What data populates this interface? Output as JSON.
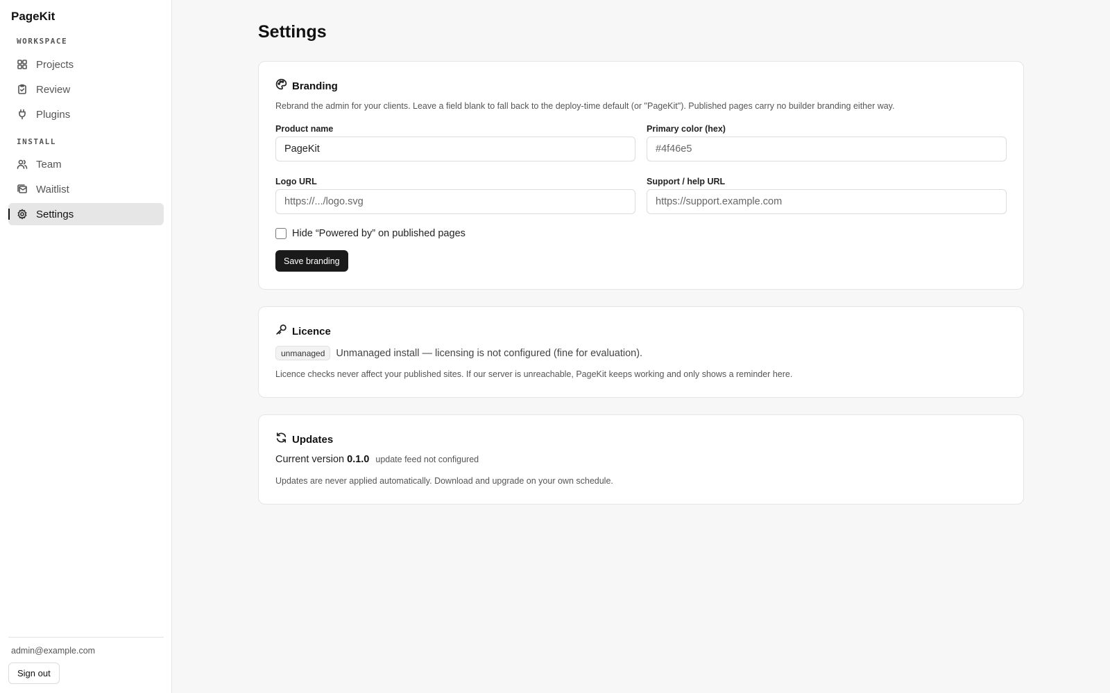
{
  "sidebar": {
    "brand": "PageKit",
    "sections": [
      {
        "label": "WORKSPACE",
        "items": [
          {
            "label": "Projects",
            "icon": "grid-icon"
          },
          {
            "label": "Review",
            "icon": "clipboard-check-icon"
          },
          {
            "label": "Plugins",
            "icon": "plug-icon"
          }
        ]
      },
      {
        "label": "INSTALL",
        "items": [
          {
            "label": "Team",
            "icon": "users-icon"
          },
          {
            "label": "Waitlist",
            "icon": "mail-stack-icon"
          },
          {
            "label": "Settings",
            "icon": "gear-icon",
            "active": true
          }
        ]
      }
    ],
    "user_email": "admin@example.com",
    "sign_out_label": "Sign out"
  },
  "page": {
    "title": "Settings"
  },
  "branding": {
    "title": "Branding",
    "icon": "palette-icon",
    "description": "Rebrand the admin for your clients. Leave a field blank to fall back to the deploy-time default (or \"PageKit\"). Published pages carry no builder branding either way.",
    "product_name": {
      "label": "Product name",
      "value": "PageKit",
      "placeholder": ""
    },
    "primary_color": {
      "label": "Primary color (hex)",
      "value": "",
      "placeholder": "#4f46e5"
    },
    "logo_url": {
      "label": "Logo URL",
      "value": "",
      "placeholder": "https://.../logo.svg"
    },
    "support_url": {
      "label": "Support / help URL",
      "value": "",
      "placeholder": "https://support.example.com"
    },
    "hide_powered_by_label": "Hide “Powered by” on published pages",
    "hide_powered_by_checked": false,
    "save_label": "Save branding"
  },
  "licence": {
    "title": "Licence",
    "icon": "key-icon",
    "badge": "unmanaged",
    "status_text": "Unmanaged install — licensing is not configured (fine for evaluation).",
    "note": "Licence checks never affect your published sites. If our server is unreachable, PageKit keeps working and only shows a reminder here."
  },
  "updates": {
    "title": "Updates",
    "icon": "refresh-icon",
    "version_label": "Current version",
    "version": "0.1.0",
    "feed_status": "update feed not configured",
    "note": "Updates are never applied automatically. Download and upgrade on your own schedule."
  }
}
